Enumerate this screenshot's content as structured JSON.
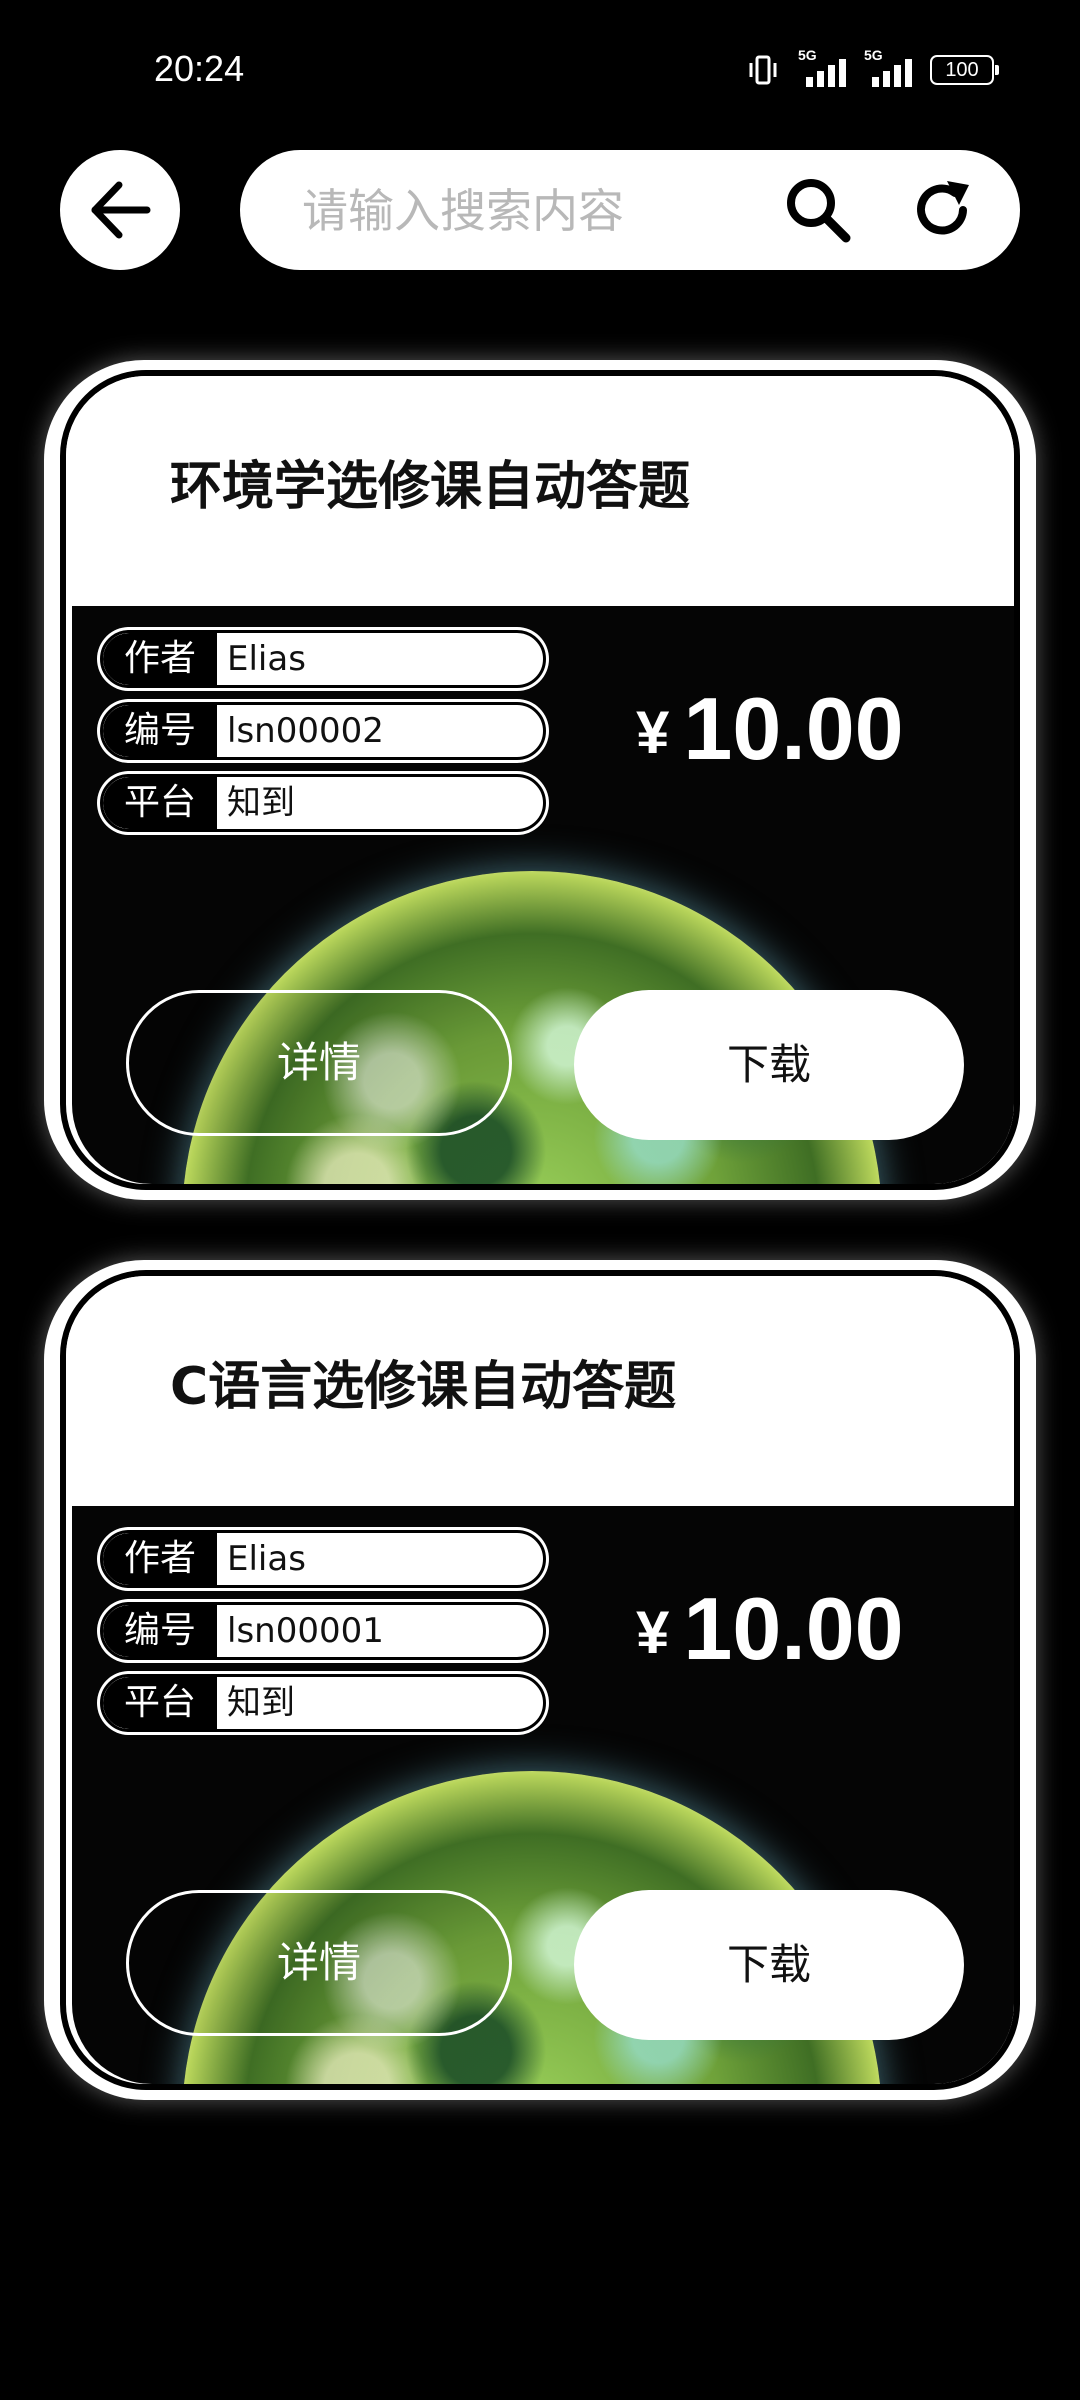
{
  "status_bar": {
    "time": "20:24",
    "battery": "100",
    "network_tag_1": "5G",
    "network_tag_2": "5G"
  },
  "search": {
    "placeholder": "请输入搜索内容"
  },
  "icons": {
    "back": "arrow-left-icon",
    "search": "search-icon",
    "refresh": "refresh-icon"
  },
  "cards": [
    {
      "title": "环境学选修课自动答题",
      "author_label": "作者",
      "author": "Elias",
      "id_label": "编号",
      "id": "lsn00002",
      "platform_label": "平台",
      "platform": "知到",
      "currency": "¥",
      "price": "10.00",
      "detail_label": "详情",
      "download_label": "下载"
    },
    {
      "title": "C语言选修课自动答题",
      "author_label": "作者",
      "author": "Elias",
      "id_label": "编号",
      "id": "lsn00001",
      "platform_label": "平台",
      "platform": "知到",
      "currency": "¥",
      "price": "10.00",
      "detail_label": "详情",
      "download_label": "下载"
    }
  ],
  "colors": {
    "background": "#000000",
    "card": "#ffffff",
    "text_dark": "#111111",
    "placeholder": "#b8b8b8"
  }
}
